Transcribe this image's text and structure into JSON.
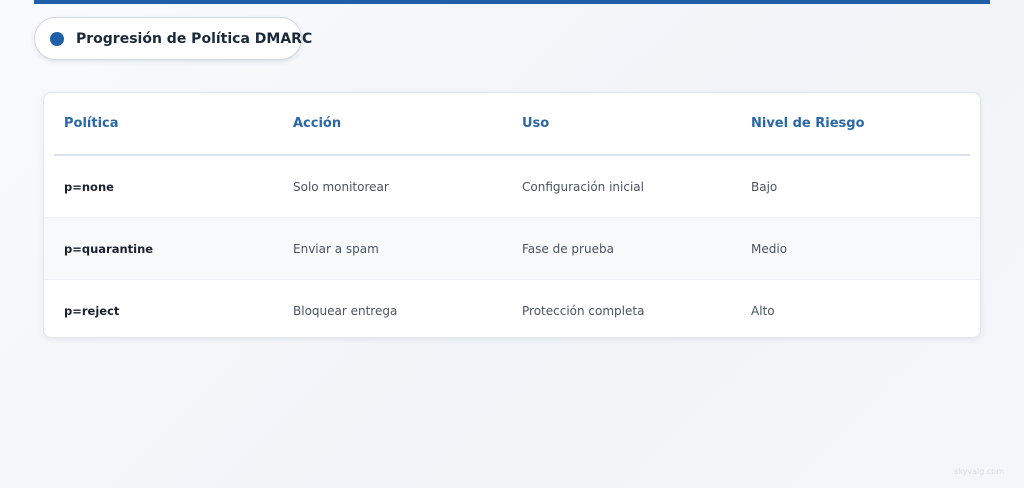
{
  "title": "Progresión de Política DMARC",
  "colors": {
    "accent": "#1f5fa8",
    "header_text": "#2a67a6"
  },
  "table": {
    "headers": [
      "Política",
      "Acción",
      "Uso",
      "Nivel de Riesgo"
    ],
    "rows": [
      [
        "p=none",
        "Solo monitorear",
        "Configuración inicial",
        "Bajo"
      ],
      [
        "p=quarantine",
        "Enviar a spam",
        "Fase de prueba",
        "Medio"
      ],
      [
        "p=reject",
        "Bloquear entrega",
        "Protección completa",
        "Alto"
      ]
    ]
  },
  "watermark": "skyvalg.com"
}
